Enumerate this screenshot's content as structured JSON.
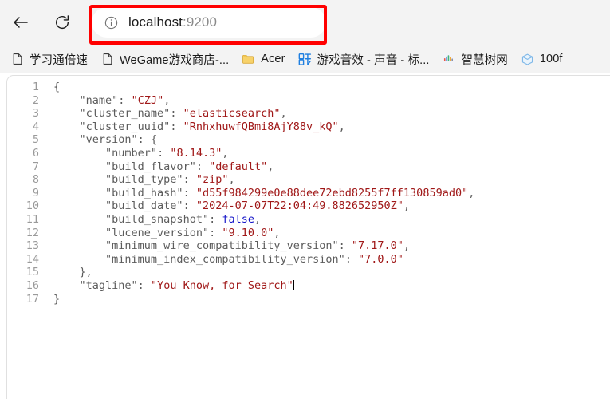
{
  "browser": {
    "back_label": "Back",
    "reload_label": "Refresh",
    "address": {
      "host": "localhost",
      "port": ":9200",
      "full": "localhost:9200",
      "site_info_icon": "info-circle-icon",
      "highlight_color": "#ff0000"
    },
    "bookmarks": [
      {
        "label": "学习通倍速",
        "icon": "page-icon"
      },
      {
        "label": "WeGame游戏商店-...",
        "icon": "page-icon"
      },
      {
        "label": "Acer",
        "icon": "folder-icon"
      },
      {
        "label": "游戏音效 - 声音 - 标...",
        "icon": "erling-logo-icon"
      },
      {
        "label": "智慧树网",
        "icon": "waveform-icon"
      },
      {
        "label": "100f",
        "icon": "cube-icon"
      }
    ]
  },
  "json_viewer": {
    "line_numbers": [
      "1",
      "2",
      "3",
      "4",
      "5",
      "6",
      "7",
      "8",
      "9",
      "10",
      "11",
      "12",
      "13",
      "14",
      "15",
      "16",
      "17"
    ],
    "colors": {
      "key": "#5c5c5c",
      "string": "#a01818",
      "boolean": "#1414c8",
      "line_number": "#9a9a9a"
    },
    "document": {
      "name": "CZJ",
      "cluster_name": "elasticsearch",
      "cluster_uuid": "RnhxhuwfQBmi8AjY88v_kQ",
      "version": {
        "number": "8.14.3",
        "build_flavor": "default",
        "build_type": "zip",
        "build_hash": "d55f984299e0e88dee72ebd8255f7ff130859ad0",
        "build_date": "2024-07-07T22:04:49.882652950Z",
        "build_snapshot": "false",
        "lucene_version": "9.10.0",
        "minimum_wire_compatibility_version": "7.17.0",
        "minimum_index_compatibility_version": "7.0.0"
      },
      "tagline": "You Know, for Search"
    },
    "lines": [
      "{",
      "    \"name\": \"CZJ\",",
      "    \"cluster_name\": \"elasticsearch\",",
      "    \"cluster_uuid\": \"RnhxhuwfQBmi8AjY88v_kQ\",",
      "    \"version\": {",
      "        \"number\": \"8.14.3\",",
      "        \"build_flavor\": \"default\",",
      "        \"build_type\": \"zip\",",
      "        \"build_hash\": \"d55f984299e0e88dee72ebd8255f7ff130859ad0\",",
      "        \"build_date\": \"2024-07-07T22:04:49.882652950Z\",",
      "        \"build_snapshot\": false,",
      "        \"lucene_version\": \"9.10.0\",",
      "        \"minimum_wire_compatibility_version\": \"7.17.0\",",
      "        \"minimum_index_compatibility_version\": \"7.0.0\"",
      "    },",
      "    \"tagline\": \"You Know, for Search\"",
      "}"
    ]
  }
}
